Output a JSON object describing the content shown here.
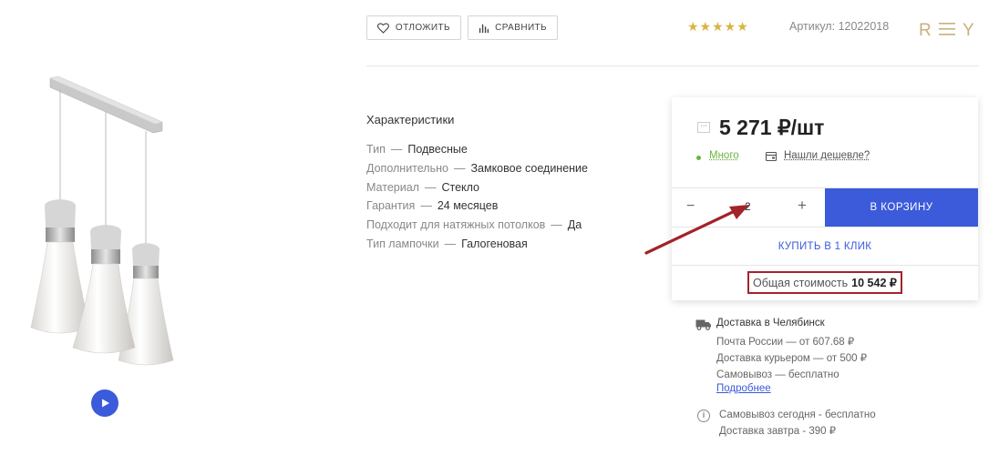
{
  "actions": {
    "postpone_label": "ОТЛОЖИТЬ",
    "compare_label": "СРАВНИТЬ"
  },
  "rating": {
    "stars_text": "★★★★★",
    "value": 5,
    "max": 5
  },
  "article": {
    "label": "Артикул:",
    "value": "12022018"
  },
  "brand": {
    "logo_text": "R Y"
  },
  "specs": {
    "title": "Характеристики",
    "items": [
      {
        "key": "Тип",
        "value": "Подвесные"
      },
      {
        "key": "Дополнительно",
        "value": "Замковое соединение"
      },
      {
        "key": "Материал",
        "value": "Стекло"
      },
      {
        "key": "Гарантия",
        "value": "24 месяцев"
      },
      {
        "key": "Подходит для натяжных потолков",
        "value": "Да"
      },
      {
        "key": "Тип лампочки",
        "value": "Галогеновая"
      }
    ]
  },
  "price": {
    "menu_icon": "···",
    "value": "5 271 ₽/шт",
    "stock_label": "Много",
    "cheaper_link": "Нашли дешевле?"
  },
  "quantity": {
    "minus": "−",
    "value": "2",
    "plus": "+"
  },
  "cart_button": "В КОРЗИНУ",
  "one_click": "КУПИТЬ В 1 КЛИК",
  "total": {
    "label": "Общая стоимость",
    "value": "10 542 ₽"
  },
  "delivery": {
    "title": "Доставка в Челябинск",
    "items": [
      "Почта России — от 607.68 ₽",
      "Доставка курьером — от 500 ₽",
      "Самовывоз — бесплатно"
    ],
    "more_link": "Подробнее"
  },
  "pickup": {
    "info_icon": "i",
    "items": [
      "Самовывоз сегодня - бесплатно",
      "Доставка завтра - 390 ₽"
    ]
  },
  "colors": {
    "accent_blue": "#3b5bdb",
    "stock_green": "#6db33f",
    "star_gold": "#d9b441",
    "highlight_red": "#a3232a"
  }
}
